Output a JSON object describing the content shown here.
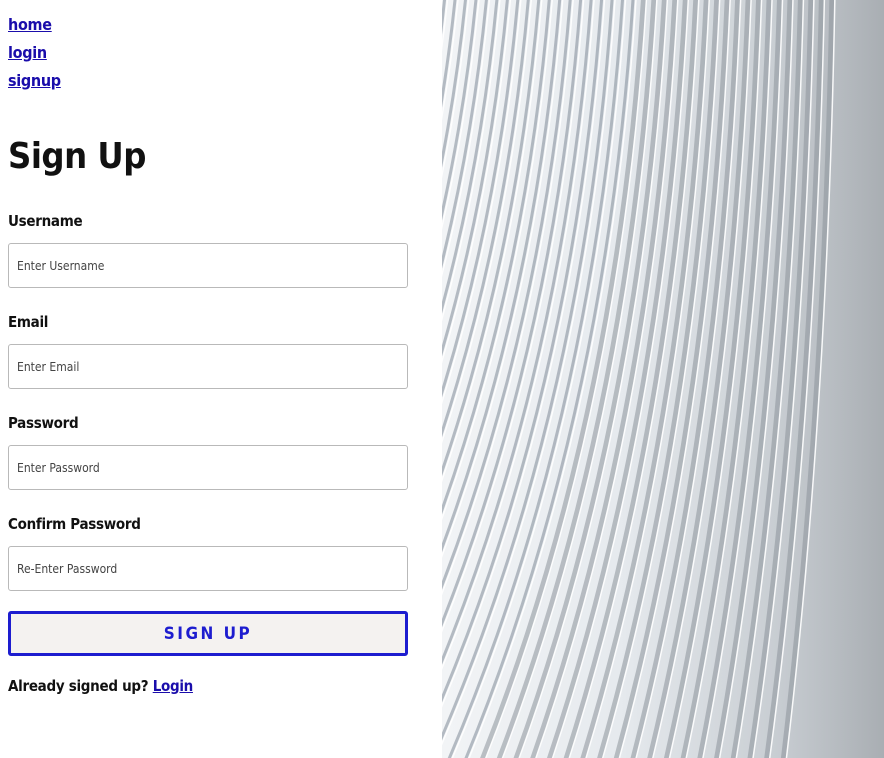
{
  "nav": {
    "home": "home",
    "login": "login",
    "signup": "signup"
  },
  "form": {
    "title": "Sign Up",
    "username": {
      "label": "Username",
      "placeholder": "Enter Username"
    },
    "email": {
      "label": "Email",
      "placeholder": "Enter Email"
    },
    "password": {
      "label": "Password",
      "placeholder": "Enter Password"
    },
    "confirm": {
      "label": "Confirm Password",
      "placeholder": "Re-Enter Password"
    },
    "submit_label": "SIGN UP"
  },
  "footer": {
    "prompt": "Already signed up?",
    "login_link": "Login"
  },
  "colors": {
    "link": "#1a0dab",
    "button_border": "#1d1dcf",
    "button_bg": "#f4f2f0"
  },
  "image": {
    "icon": "architecture-ribs-photo"
  }
}
